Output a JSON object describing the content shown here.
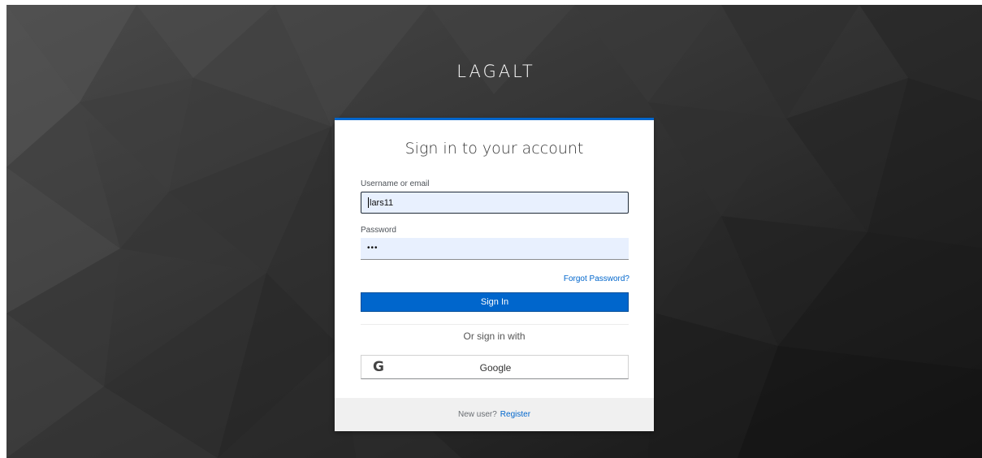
{
  "brand": "LAGALT",
  "form": {
    "title": "Sign in to your account",
    "username_label": "Username or email",
    "username_value": "lars11",
    "password_label": "Password",
    "password_value": "•••",
    "forgot_link": "Forgot Password?",
    "signin_button": "Sign In",
    "social_divider": "Or sign in with",
    "google_icon": "G",
    "google_button": "Google"
  },
  "footer": {
    "new_user_text": "New user?",
    "register_link": "Register"
  },
  "colors": {
    "accent": "#0066cc",
    "input_bg": "#e8f0fe",
    "footer_bg": "#f0f0f0"
  },
  "icons": {
    "google": "google-icon"
  }
}
